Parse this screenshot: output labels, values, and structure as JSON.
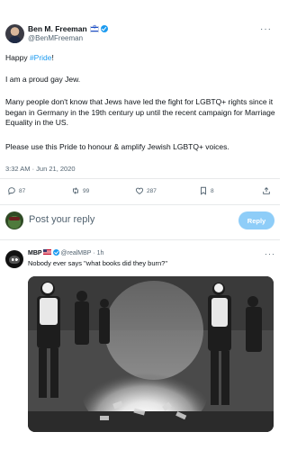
{
  "tweet": {
    "author_name": "Ben M. Freeman",
    "author_handle": "@BenMFreeman",
    "line1_prefix": "Happy ",
    "hashtag": "#Pride",
    "line1_suffix": "!",
    "line2": "I am a proud gay Jew.",
    "line3": "Many people don't know that Jews have led the fight for LGBTQ+ rights since it began in Germany in the 19th century up until the recent campaign for Marriage Equality in the US.",
    "line4": "Please use this Pride to honour & amplify Jewish LGBTQ+ voices.",
    "timestamp": "3:32 AM · Jun 21, 2020",
    "more_icon": "more-horizontal-icon"
  },
  "actions": {
    "reply_count": "87",
    "retweet_count": "99",
    "like_count": "287",
    "bookmark_count": "8"
  },
  "compose": {
    "placeholder": "Post your reply",
    "reply_button": "Reply"
  },
  "reply": {
    "author_name": "MBP",
    "author_handle": "@realMBP",
    "time": "1h",
    "text": "Nobody ever says \"what books did they burn?\""
  },
  "colors": {
    "accent": "#1d9bf0",
    "reply_button_disabled": "#8ecdf8",
    "secondary_text": "#536471"
  }
}
